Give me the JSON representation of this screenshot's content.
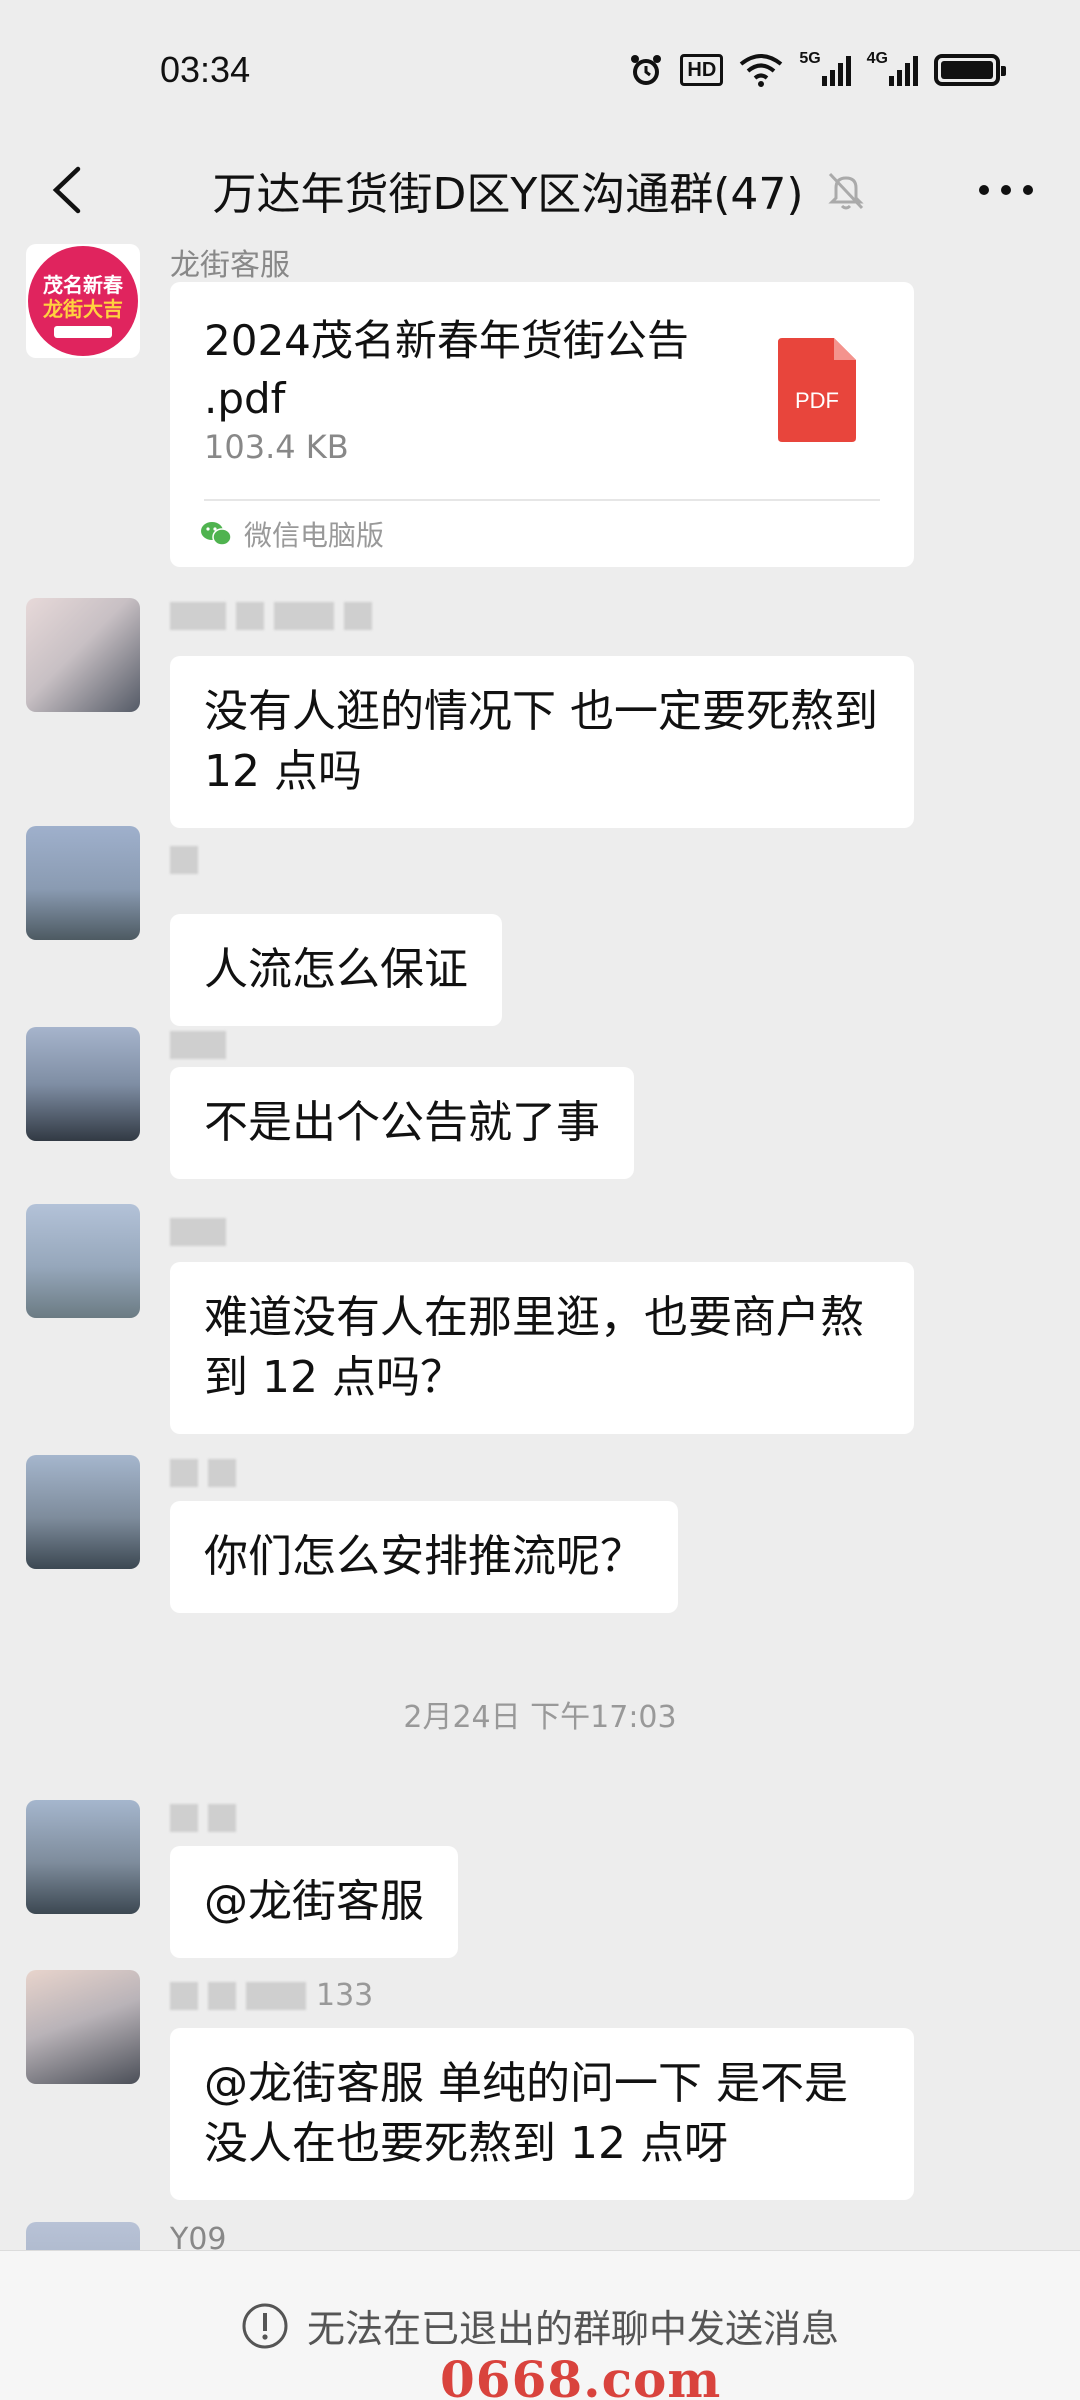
{
  "status_bar": {
    "time": "03:34",
    "icons": [
      "alarm-icon",
      "hd-icon",
      "wifi-icon",
      "5g-signal-icon",
      "4g-signal-icon",
      "battery-icon"
    ],
    "hd_label": "HD",
    "net1_label": "5G",
    "net2_label": "4G"
  },
  "nav": {
    "title": "万达年货街D区Y区沟通群(47)",
    "back_icon": "chevron-left-icon",
    "mute_icon": "bell-off-icon",
    "more_icon": "more-dots-icon"
  },
  "messages": [
    {
      "sender": "龙街客服",
      "type": "file",
      "file": {
        "name": "2024茂名新春年货街公告 .pdf",
        "size": "103.4 KB",
        "icon_label": "PDF",
        "source": "微信电脑版"
      }
    },
    {
      "type": "text",
      "lines": [
        "没有人逛的情况下 也一定要死熬到",
        "12 点吗"
      ]
    },
    {
      "type": "text",
      "lines": [
        "人流怎么保证"
      ]
    },
    {
      "type": "text",
      "lines": [
        "不是出个公告就了事"
      ]
    },
    {
      "type": "text",
      "lines": [
        "难道没有人在那里逛，也要商户熬",
        "到 12 点吗？"
      ]
    },
    {
      "type": "text",
      "lines": [
        "你们怎么安排推流呢？"
      ]
    },
    {
      "type": "text",
      "lines": [
        "@龙街客服"
      ]
    },
    {
      "type": "text",
      "sender_suffix": "133",
      "lines": [
        "@龙街客服  单纯的问一下 是不是",
        "没人在也要死熬到 12 点呀"
      ]
    },
    {
      "type": "partial",
      "sender": "Y09"
    }
  ],
  "timestamp": "2月24日 下午17:03",
  "bottom": {
    "notice": "无法在已退出的群聊中发送消息",
    "icon": "exclamation-circle-icon"
  },
  "watermark": "0668.com",
  "colors": {
    "background": "#ededed",
    "bubble": "#ffffff",
    "pdf_red": "#e8453c",
    "wechat_green": "#4fb34f",
    "avatar_pink": "#e0245e"
  }
}
